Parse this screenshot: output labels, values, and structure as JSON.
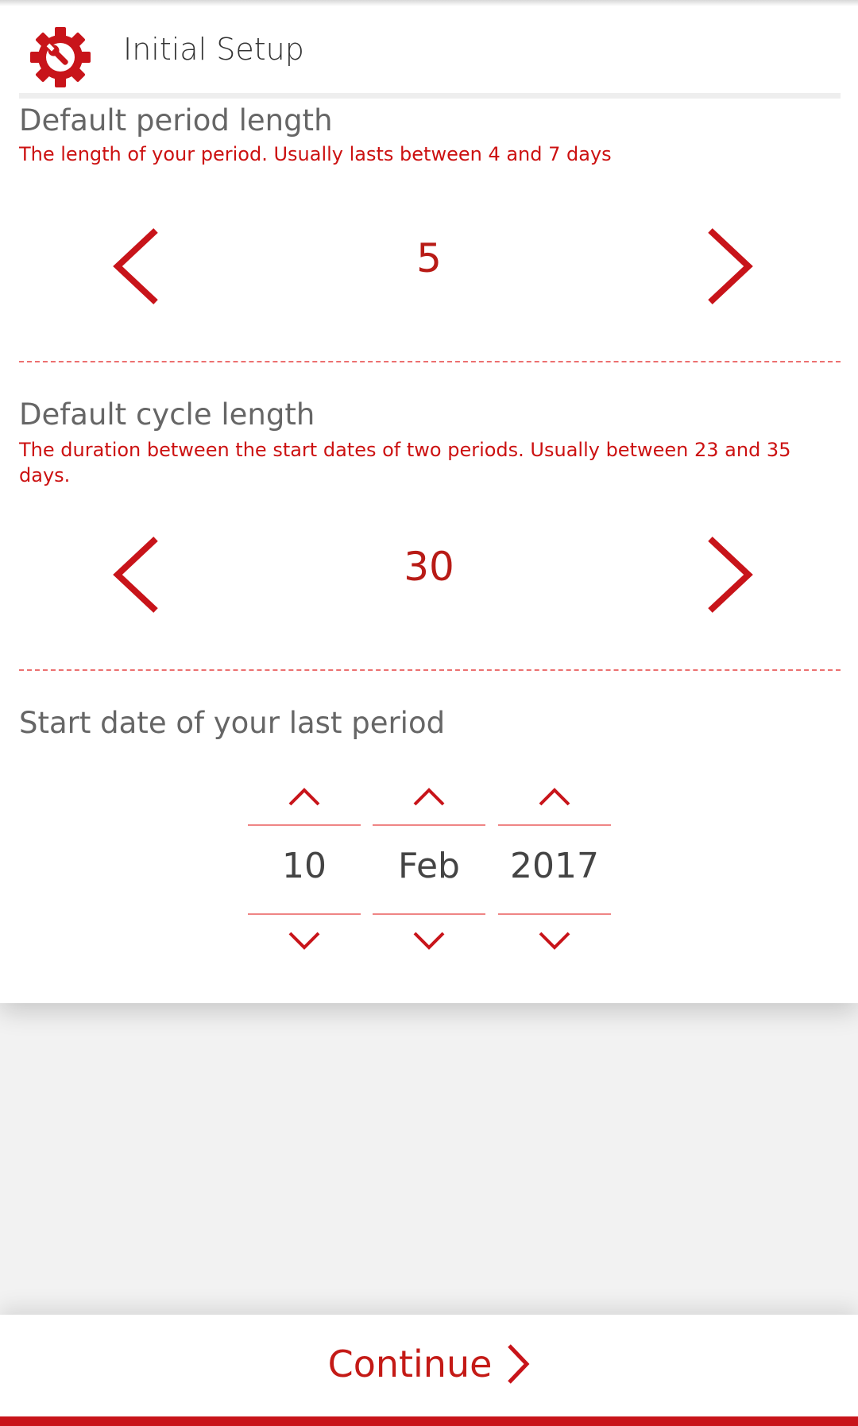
{
  "colors": {
    "accent": "#c8141a",
    "subtitle": "#cc1111",
    "title_gray": "#666666"
  },
  "header": {
    "title": "Initial Setup",
    "icon": "gear-wrench-icon"
  },
  "period": {
    "title": "Default period length",
    "description": "The length of your period. Usually lasts between 4 and 7 days",
    "value": "5"
  },
  "cycle": {
    "title": "Default cycle length",
    "description": "The duration between the start dates of two periods. Usually between 23 and 35 days.",
    "value": "30"
  },
  "last_period": {
    "title": "Start date of your last period",
    "day": "10",
    "month": "Feb",
    "year": "2017"
  },
  "footer": {
    "continue_label": "Continue"
  }
}
